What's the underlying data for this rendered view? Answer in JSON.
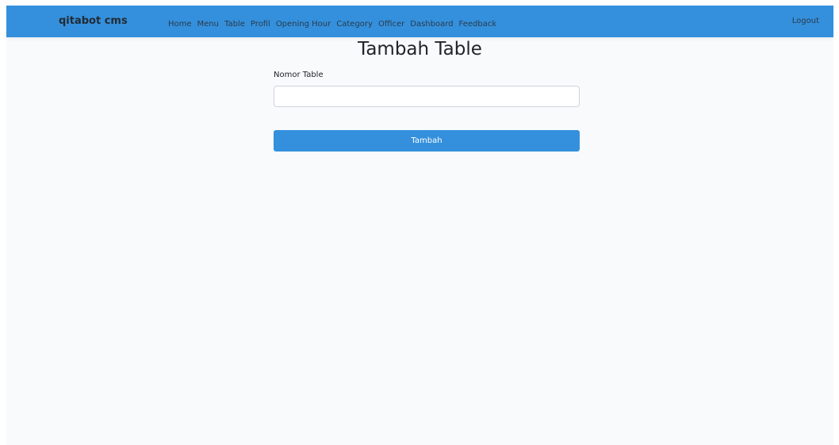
{
  "navbar": {
    "brand": "qitabot cms",
    "links": [
      {
        "label": "Home"
      },
      {
        "label": "Menu"
      },
      {
        "label": "Table"
      },
      {
        "label": "Profil"
      },
      {
        "label": "Opening Hour"
      },
      {
        "label": "Category"
      },
      {
        "label": "Officer"
      },
      {
        "label": "Dashboard"
      },
      {
        "label": "Feedback"
      }
    ],
    "logout_label": "Logout"
  },
  "page": {
    "title": "Tambah Table"
  },
  "form": {
    "nomor_table": {
      "label": "Nomor Table",
      "value": "",
      "placeholder": ""
    },
    "submit_label": "Tambah"
  },
  "colors": {
    "navbar_bg": "#3490dc",
    "page_bg": "#f8fafc",
    "button_bg": "#3490dc",
    "button_text": "#ffffff"
  }
}
